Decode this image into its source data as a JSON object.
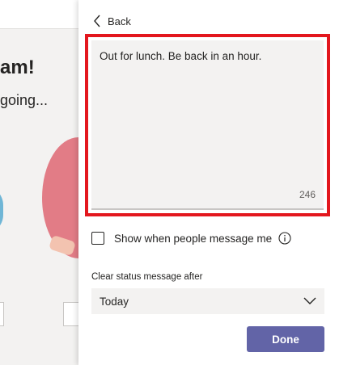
{
  "background": {
    "heading": "am!",
    "subheading": "going..."
  },
  "panel": {
    "back_label": "Back",
    "status_message": "Out for lunch. Be back in an hour.",
    "char_counter": "246",
    "show_when_message_label": "Show when people message me",
    "clear_after_label": "Clear status message after",
    "clear_after_value": "Today",
    "done_label": "Done"
  },
  "colors": {
    "accent": "#6264a7",
    "highlight_border": "#e3171e",
    "field_bg": "#f3f2f1"
  },
  "icons": [
    "chevron-left-icon",
    "info-icon",
    "chevron-down-icon"
  ]
}
